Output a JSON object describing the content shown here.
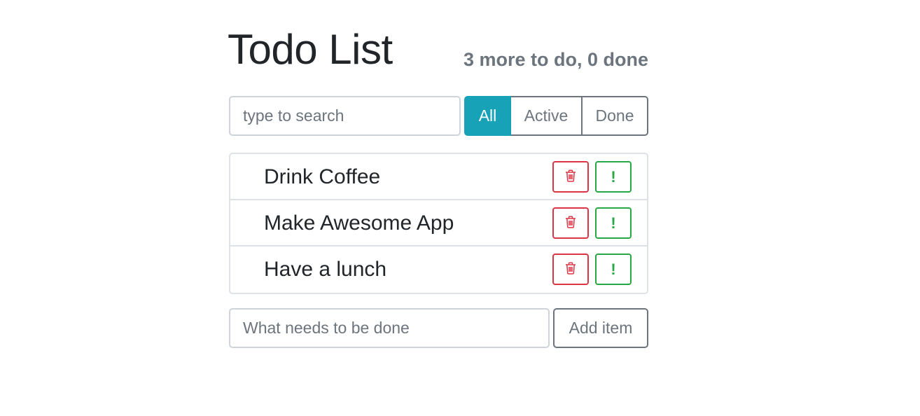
{
  "header": {
    "title": "Todo List",
    "status": "3 more to do, 0 done"
  },
  "search": {
    "placeholder": "type to search",
    "value": ""
  },
  "filters": [
    {
      "label": "All",
      "selected": true
    },
    {
      "label": "Active",
      "selected": false
    },
    {
      "label": "Done",
      "selected": false
    }
  ],
  "todos": [
    {
      "label": "Drink Coffee",
      "delete_icon": "trash-icon",
      "important_icon": "exclamation-icon",
      "important_glyph": "!"
    },
    {
      "label": "Make Awesome App",
      "delete_icon": "trash-icon",
      "important_icon": "exclamation-icon",
      "important_glyph": "!"
    },
    {
      "label": "Have a lunch",
      "delete_icon": "trash-icon",
      "important_icon": "exclamation-icon",
      "important_glyph": "!"
    }
  ],
  "add_form": {
    "placeholder": "What needs to be done",
    "value": "",
    "button_label": "Add item"
  },
  "colors": {
    "accent": "#17a2b8",
    "danger": "#dc3545",
    "success": "#28a745",
    "muted": "#6c757d"
  }
}
